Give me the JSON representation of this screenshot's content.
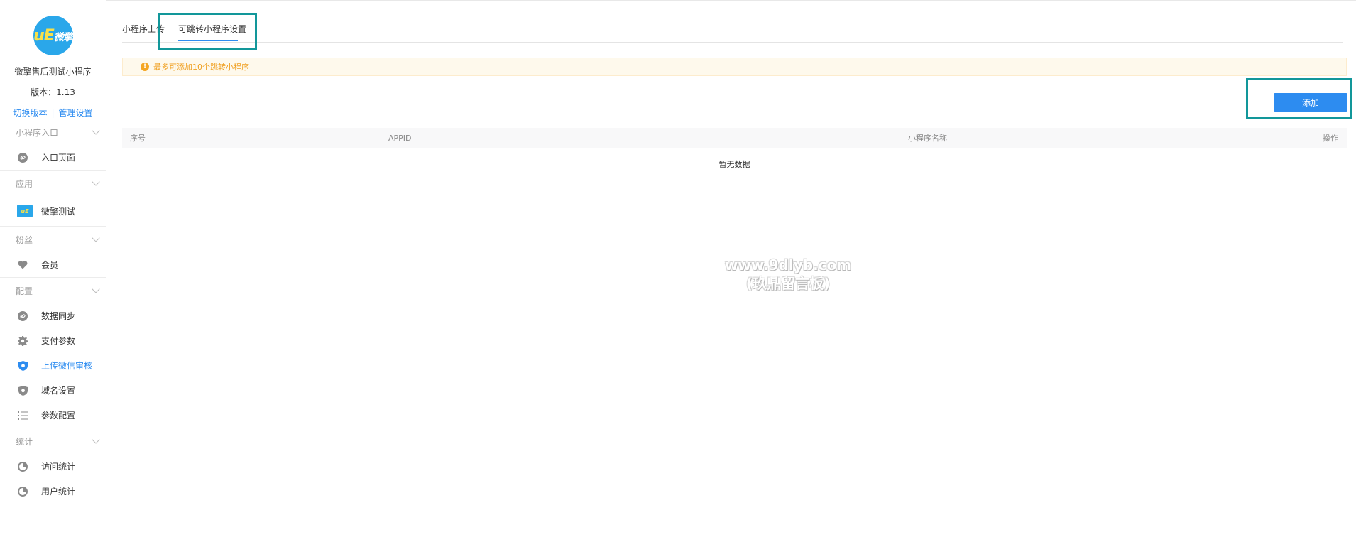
{
  "sidebar": {
    "logo_text": "微擎",
    "app_name": "微擎售后测试小程序",
    "version": "版本：1.13",
    "switch_version": "切换版本",
    "separator": "|",
    "manage_settings": "管理设置",
    "groups": [
      {
        "title": "小程序入口",
        "items": [
          {
            "label": "入口页面",
            "icon": "link-icon"
          }
        ]
      },
      {
        "title": "应用",
        "items": [
          {
            "label": "微擎测试",
            "icon": "app-logo-icon"
          }
        ]
      },
      {
        "title": "粉丝",
        "items": [
          {
            "label": "会员",
            "icon": "heart-icon"
          }
        ]
      },
      {
        "title": "配置",
        "items": [
          {
            "label": "数据同步",
            "icon": "link-icon"
          },
          {
            "label": "支付参数",
            "icon": "gear-icon"
          },
          {
            "label": "上传微信审核",
            "icon": "shield-icon",
            "active": true
          },
          {
            "label": "域名设置",
            "icon": "shield-icon"
          },
          {
            "label": "参数配置",
            "icon": "list-icon"
          }
        ]
      },
      {
        "title": "统计",
        "items": [
          {
            "label": "访问统计",
            "icon": "pie-chart-icon"
          },
          {
            "label": "用户统计",
            "icon": "pie-chart-icon"
          }
        ]
      }
    ]
  },
  "tabs": {
    "upload": "小程序上传",
    "jump_settings": "可跳转小程序设置"
  },
  "notice": {
    "icon": "!",
    "text": "最多可添加10个跳转小程序"
  },
  "add_button": "添加",
  "table": {
    "headers": {
      "index": "序号",
      "appid": "APPID",
      "name": "小程序名称",
      "action": "操作"
    },
    "empty": "暂无数据"
  },
  "watermark": {
    "line1": "www.9dlyb.com",
    "line2": "(玖鼎留言板)"
  },
  "colors": {
    "accent": "#2d8cf0",
    "highlight_box": "#12979a",
    "notice_text": "#f0a020",
    "logo_bg": "#2aa7ea"
  }
}
